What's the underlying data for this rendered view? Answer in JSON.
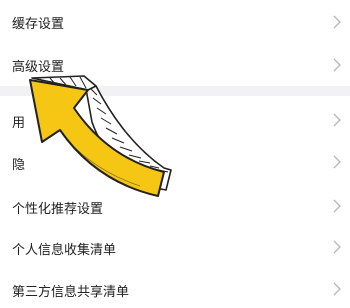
{
  "settings_list": {
    "items": [
      {
        "label": "缓存设置"
      },
      {
        "label": "高级设置"
      },
      {
        "label": "用"
      },
      {
        "label": "隐"
      },
      {
        "label": "个性化推荐设置"
      },
      {
        "label": "个人信息收集清单"
      },
      {
        "label": "第三方信息共享清单"
      }
    ]
  },
  "overlay": {
    "icon": "yellow-arrow-pointer-icon",
    "fill_color": "#f6c614",
    "outline_color": "#222222"
  }
}
